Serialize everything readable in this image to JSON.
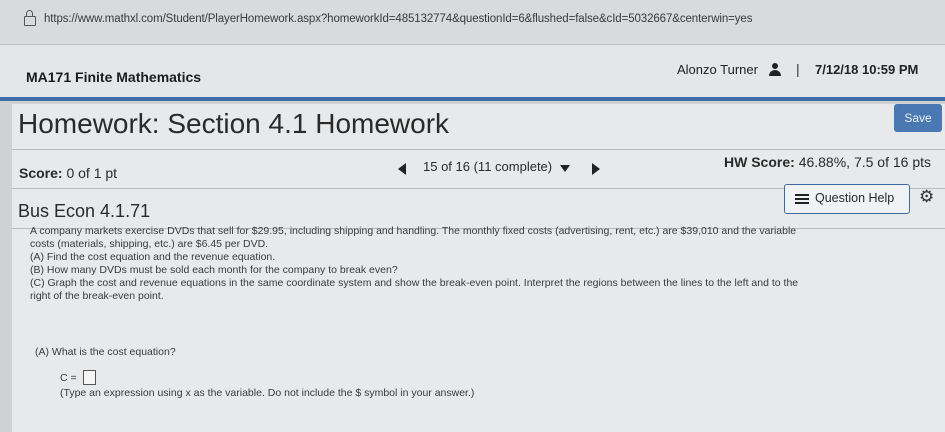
{
  "browser": {
    "url": "https://www.mathxl.com/Student/PlayerHomework.aspx?homeworkId=485132774&questionId=6&flushed=false&cId=5032667&centerwin=yes"
  },
  "header": {
    "course": "MA171 Finite Mathematics",
    "user": "Alonzo Turner",
    "separator": "|",
    "datetime": "7/12/18 10:59 PM"
  },
  "homework": {
    "title": "Homework: Section 4.1 Homework",
    "save_label": "Save",
    "score_label": "Score:",
    "score_value": "0 of 1 pt",
    "nav_text": "15 of 16 (11 complete)",
    "hw_score_label": "HW Score:",
    "hw_score_value": "46.88%, 7.5 of 16 pts"
  },
  "question": {
    "id": "Bus Econ 4.1.71",
    "help_label": "Question Help",
    "lines": [
      "A company markets exercise DVDs that sell for $29.95, including shipping and handling. The monthly fixed costs (advertising, rent, etc.) are $39,010 and the variable",
      "costs (materials, shipping, etc.) are $6.45 per DVD.",
      "(A) Find the cost equation and the revenue equation.",
      "(B) How many DVDs must be sold each month for the company to break even?",
      "(C) Graph the cost and revenue equations in the same coordinate system and show the break-even point. Interpret the regions between the lines to the left and to the",
      "right of the break-even point."
    ],
    "part_a": "(A) What is the cost equation?",
    "answer_prefix": "C =",
    "hint": "(Type an expression using x as the variable. Do not include the $ symbol in your answer.)"
  }
}
